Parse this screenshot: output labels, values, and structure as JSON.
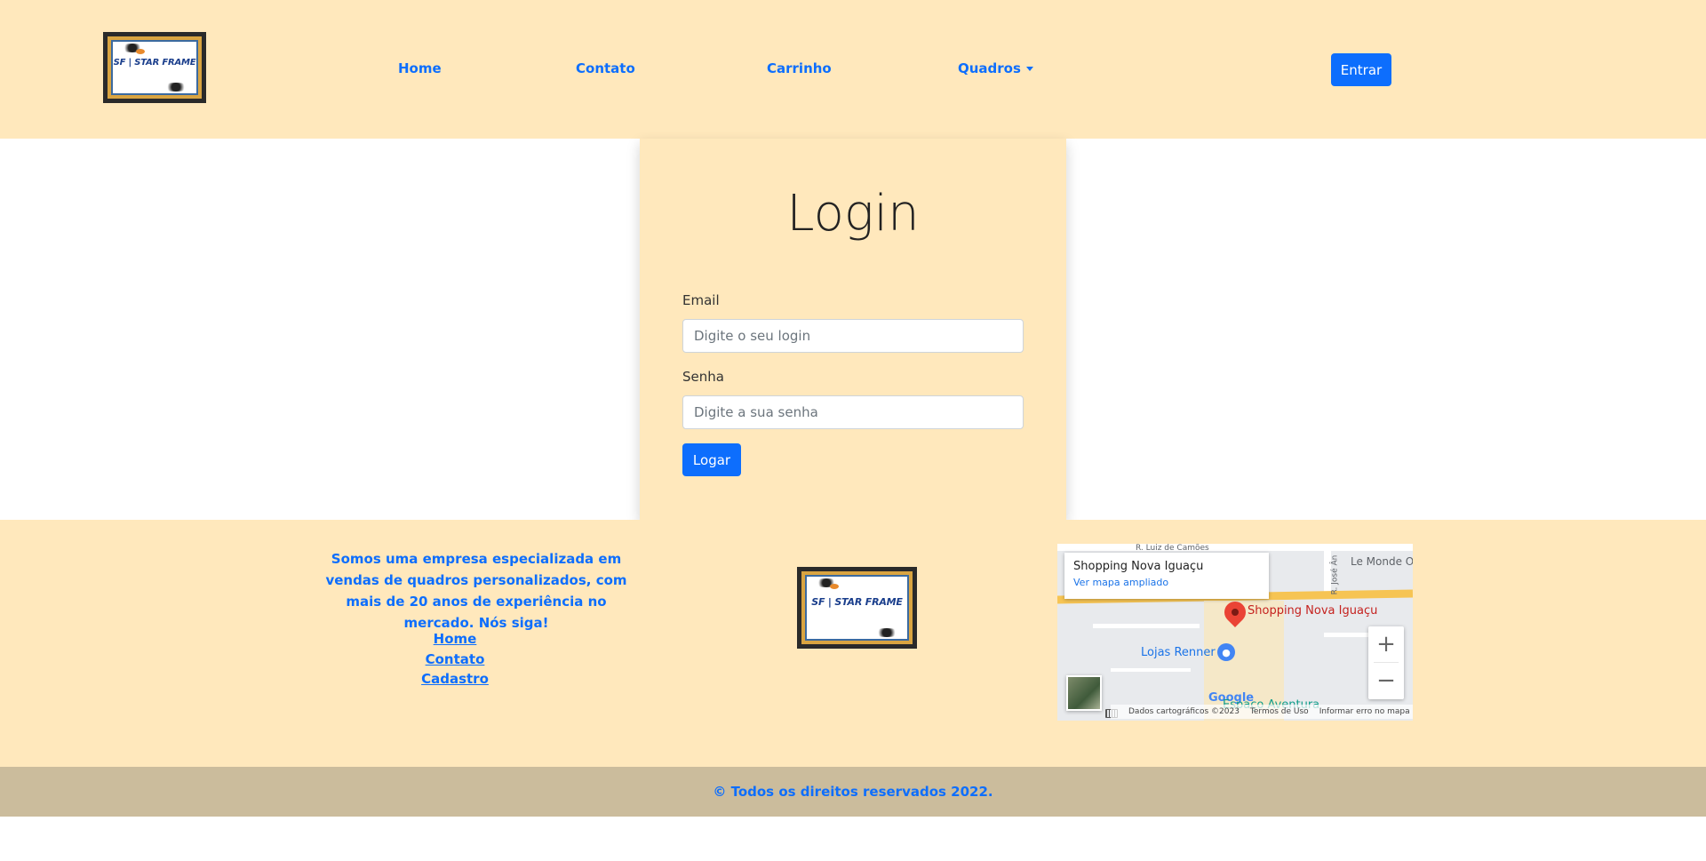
{
  "header": {
    "logo_text": "SF | STAR FRAME",
    "nav": {
      "home": "Home",
      "contato": "Contato",
      "carrinho": "Carrinho",
      "quadros": "Quadros"
    },
    "login_button": "Entrar"
  },
  "login": {
    "title": "Login",
    "email_label": "Email",
    "email_placeholder": "Digite o seu login",
    "password_label": "Senha",
    "password_placeholder": "Digite a sua senha",
    "submit": "Logar"
  },
  "footer": {
    "about": "Somos uma empresa especializada em vendas de quadros personalizados, com mais de 20 anos de experiência no mercado. Nós siga!",
    "links": [
      "Home",
      "Contato",
      "Cadastro"
    ],
    "logo_text": "SF | STAR FRAME",
    "map": {
      "place_title": "Shopping Nova Iguaçu",
      "larger_map": "Ver mapa ampliado",
      "pin_label": "Shopping Nova Iguaçu",
      "poi_label": "Lojas Renner",
      "street_top": "R. Luiz de Camões",
      "street_right": "R. José Ân",
      "shop_right": "Le Monde Off",
      "poi_bottom": "Espaço Aventura",
      "google": "Google",
      "attr_data": "Dados cartográficos ©2023",
      "attr_terms": "Termos de Uso",
      "attr_report": "Informar erro no mapa",
      "zoom_in": "+",
      "zoom_out": "−"
    },
    "copyright": "© Todos os direitos reservados 2022."
  },
  "colors": {
    "background_cream": "#ffe8bc",
    "primary": "#0d6efd",
    "copyright_bar": "#cbbc9c"
  }
}
